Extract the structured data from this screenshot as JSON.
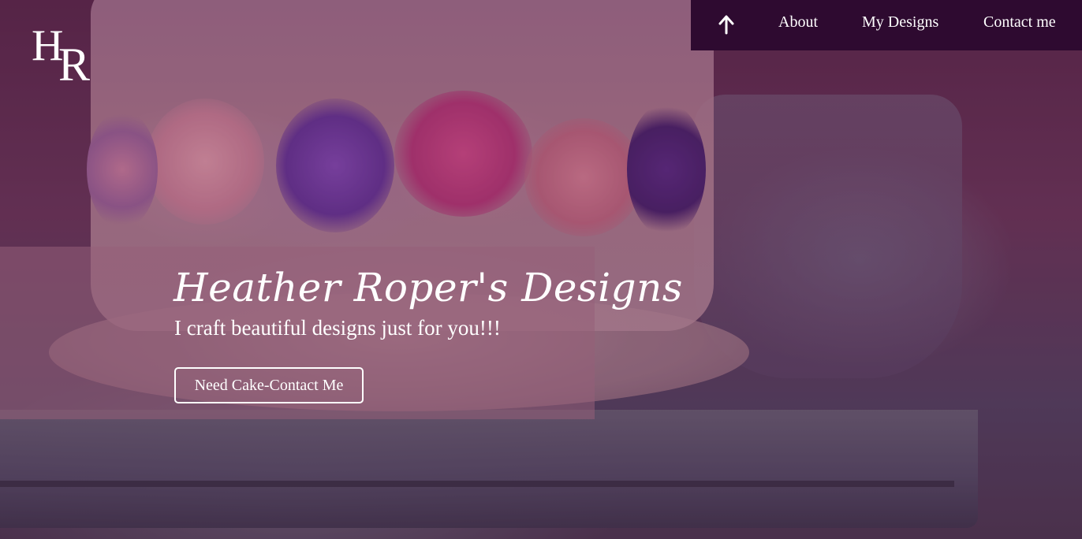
{
  "logo": {
    "letter_1": "H",
    "letter_2": "R"
  },
  "nav": {
    "up_icon": "arrow-up-icon",
    "items": [
      {
        "label": "About"
      },
      {
        "label": "My Designs"
      },
      {
        "label": "Contact me"
      }
    ]
  },
  "hero": {
    "title": "Heather Roper's Designs",
    "subtitle": "I craft beautiful designs just for you!!!",
    "cta_label": "Need Cake-Contact Me"
  },
  "colors": {
    "nav_background": "#2e0a30",
    "text": "#ffffff",
    "panel_overlay": "#965f78"
  }
}
